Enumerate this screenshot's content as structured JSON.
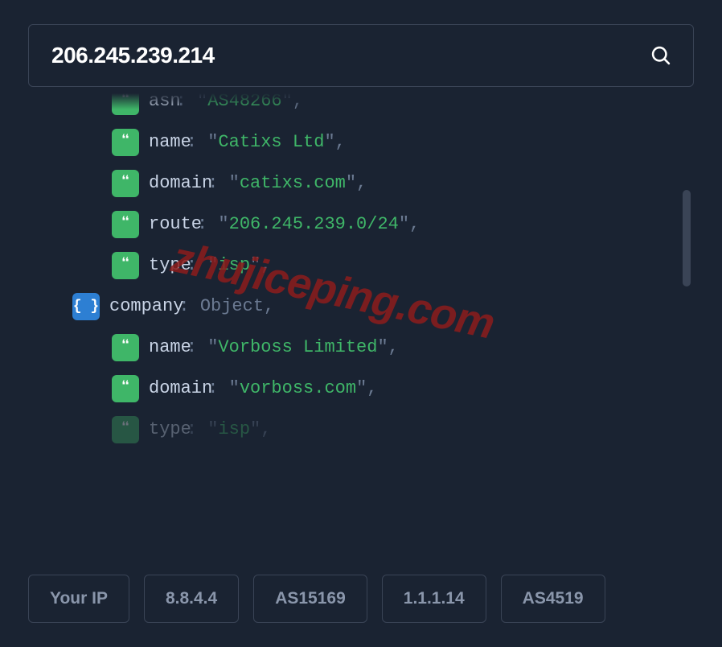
{
  "search": {
    "value": "206.245.239.214"
  },
  "json": {
    "asn": {
      "key": "asn",
      "asn_key": "asn",
      "asn_val": "AS48266",
      "name_key": "name",
      "name_val": "Catixs Ltd",
      "domain_key": "domain",
      "domain_val": "catixs.com",
      "route_key": "route",
      "route_val": "206.245.239.0/24",
      "type_key": "type",
      "type_val": "isp"
    },
    "company": {
      "key": "company",
      "obj_label": "Object",
      "name_key": "name",
      "name_val": "Vorboss Limited",
      "domain_key": "domain",
      "domain_val": "vorboss.com",
      "type_key": "type",
      "type_val": "isp"
    }
  },
  "chips": {
    "c0": "Your IP",
    "c1": "8.8.4.4",
    "c2": "AS15169",
    "c3": "1.1.1.14",
    "c4": "AS4519"
  },
  "watermark": "zhujiceping.com"
}
